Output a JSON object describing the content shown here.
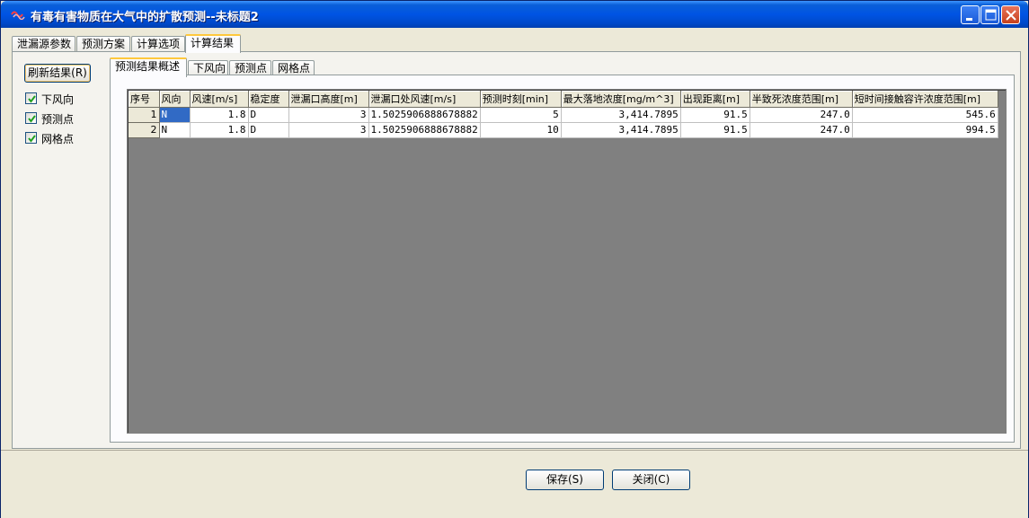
{
  "window": {
    "title": "有毒有害物质在大气中的扩散预测--未标题2"
  },
  "outer_tabs": [
    "泄漏源参数",
    "预测方案",
    "计算选项",
    "计算结果"
  ],
  "outer_active_tab": "计算结果",
  "left_panel": {
    "refresh_label": "刷新结果(R)",
    "checkboxes": [
      {
        "label": "下风向",
        "checked": true
      },
      {
        "label": "预测点",
        "checked": true
      },
      {
        "label": "网格点",
        "checked": true
      }
    ]
  },
  "inner_tabs": [
    "预测结果概述",
    "下风向",
    "预测点",
    "网格点"
  ],
  "inner_active_tab": "预测结果概述",
  "table": {
    "headers": [
      "序号",
      "风向",
      "风速[m/s]",
      "稳定度",
      "泄漏口高度[m]",
      "泄漏口处风速[m/s]",
      "预测时刻[min]",
      "最大落地浓度[mg/m^3]",
      "出现距离[m]",
      "半致死浓度范围[m]",
      "短时间接触容许浓度范围[m]"
    ],
    "rows": [
      [
        "1",
        "N",
        "1.8",
        "D",
        "3",
        "1.5025906888678882",
        "5",
        "3,414.7895",
        "91.5",
        "247.0",
        "545.6"
      ],
      [
        "2",
        "N",
        "1.8",
        "D",
        "3",
        "1.5025906888678882",
        "10",
        "3,414.7895",
        "91.5",
        "247.0",
        "994.5"
      ]
    ]
  },
  "buttons": {
    "save_label": "保存(S)",
    "close_label": "关闭(C)"
  },
  "colors": {
    "titlebar": "#0054e3",
    "selection": "#316ac5",
    "grid_background": "#808080",
    "active_tab_accent": "#ffc83c"
  }
}
